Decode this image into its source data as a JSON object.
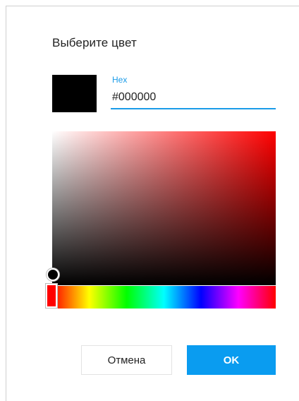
{
  "dialog": {
    "title": "Выберите цвет",
    "hex": {
      "label": "Hex",
      "value": "#000000"
    },
    "current_color": "#000000",
    "hue_color": "#ff0000",
    "accent_color": "#0a9cf0",
    "buttons": {
      "cancel_label": "Отмена",
      "ok_label": "OK"
    }
  }
}
